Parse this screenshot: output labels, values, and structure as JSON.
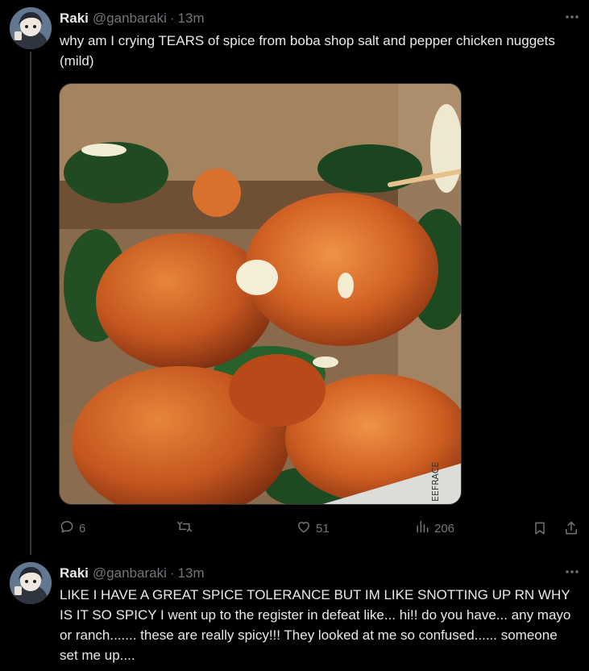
{
  "tweets": [
    {
      "author": "Raki",
      "handle": "@ganbaraki",
      "separator": "·",
      "time": "13m",
      "text": "why am I crying TEARS of spice from boba shop salt and pepper chicken nuggets (mild)",
      "media_label": "EEFRACE",
      "stats": {
        "replies": "6",
        "reposts": "",
        "likes": "51",
        "views": "206"
      }
    },
    {
      "author": "Raki",
      "handle": "@ganbaraki",
      "separator": "·",
      "time": "13m",
      "text": "LIKE I HAVE A GREAT SPICE TOLERANCE BUT IM LIKE SNOTTING UP RN WHY IS IT SO SPICY I went up to the register in defeat like... hi!! do you have... any mayo or ranch....... these are really spicy!!! They looked at me so confused...... someone set me up...."
    }
  ],
  "icons": {
    "more": "more-options-icon",
    "reply": "reply-icon",
    "repost": "repost-icon",
    "like": "like-icon",
    "views": "views-icon",
    "bookmark": "bookmark-icon",
    "share": "share-icon"
  },
  "colors": {
    "background": "#000000",
    "text_primary": "#e7e9ea",
    "text_secondary": "#71767b",
    "divider": "#333639"
  }
}
